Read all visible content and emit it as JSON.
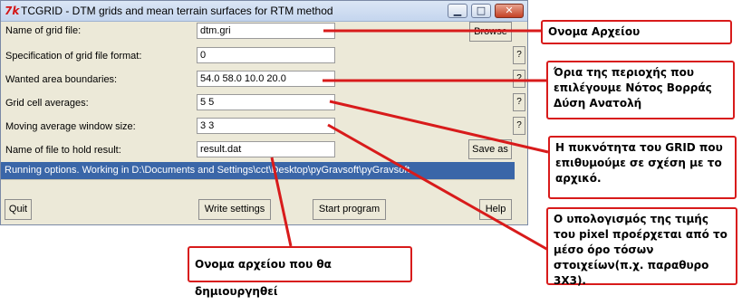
{
  "window": {
    "title": "TCGRID - DTM grids and mean terrain surfaces for RTM method",
    "app_icon": "tk-feather-icon",
    "controls": {
      "minimize": "▁",
      "maximize": "□",
      "close": "✕"
    }
  },
  "form": {
    "rows": [
      {
        "label": "Name of grid file:",
        "value": "dtm.gri",
        "button": "Browse"
      },
      {
        "label": "Specification of grid file format:",
        "value": "0",
        "button": "?"
      },
      {
        "label": "Wanted area boundaries:",
        "value": "54.0 58.0 10.0 20.0",
        "button": "?"
      },
      {
        "label": "Grid cell averages:",
        "value": "5 5",
        "button": "?"
      },
      {
        "label": "Moving average window size:",
        "value": "3 3",
        "button": "?"
      },
      {
        "label": "Name of file to hold result:",
        "value": "result.dat",
        "button": "Save as"
      }
    ]
  },
  "status": "Running options. Working in D:\\Documents and Settings\\cct\\Desktop\\pyGravsoft\\pyGravsoft",
  "buttons": {
    "quit": "Quit",
    "write_settings": "Write settings",
    "start_program": "Start program",
    "help": "Help"
  },
  "annotations": {
    "file_name": "Ονομα Αρχείου",
    "area_limits": "Όρια της περιοχής που επιλέγουμε Νότος Βορράς Δύση Ανατολή",
    "grid_density": "Η πυκνότητα του GRID που επιθυμούμε σε σχέση με το αρχικό.",
    "moving_average": "Ο υπολογισμός της τιμής του pixel  προέρχεται από το μέσο όρο τόσων στοιχείων(π.χ. παραθυρο 3Χ3).",
    "output_file": "Ονομα αρχείου που θα δημιουργηθεί"
  },
  "colors": {
    "annotation_red": "#d81b1b",
    "status_blue": "#3a66a8",
    "window_bg": "#ece9d8"
  }
}
